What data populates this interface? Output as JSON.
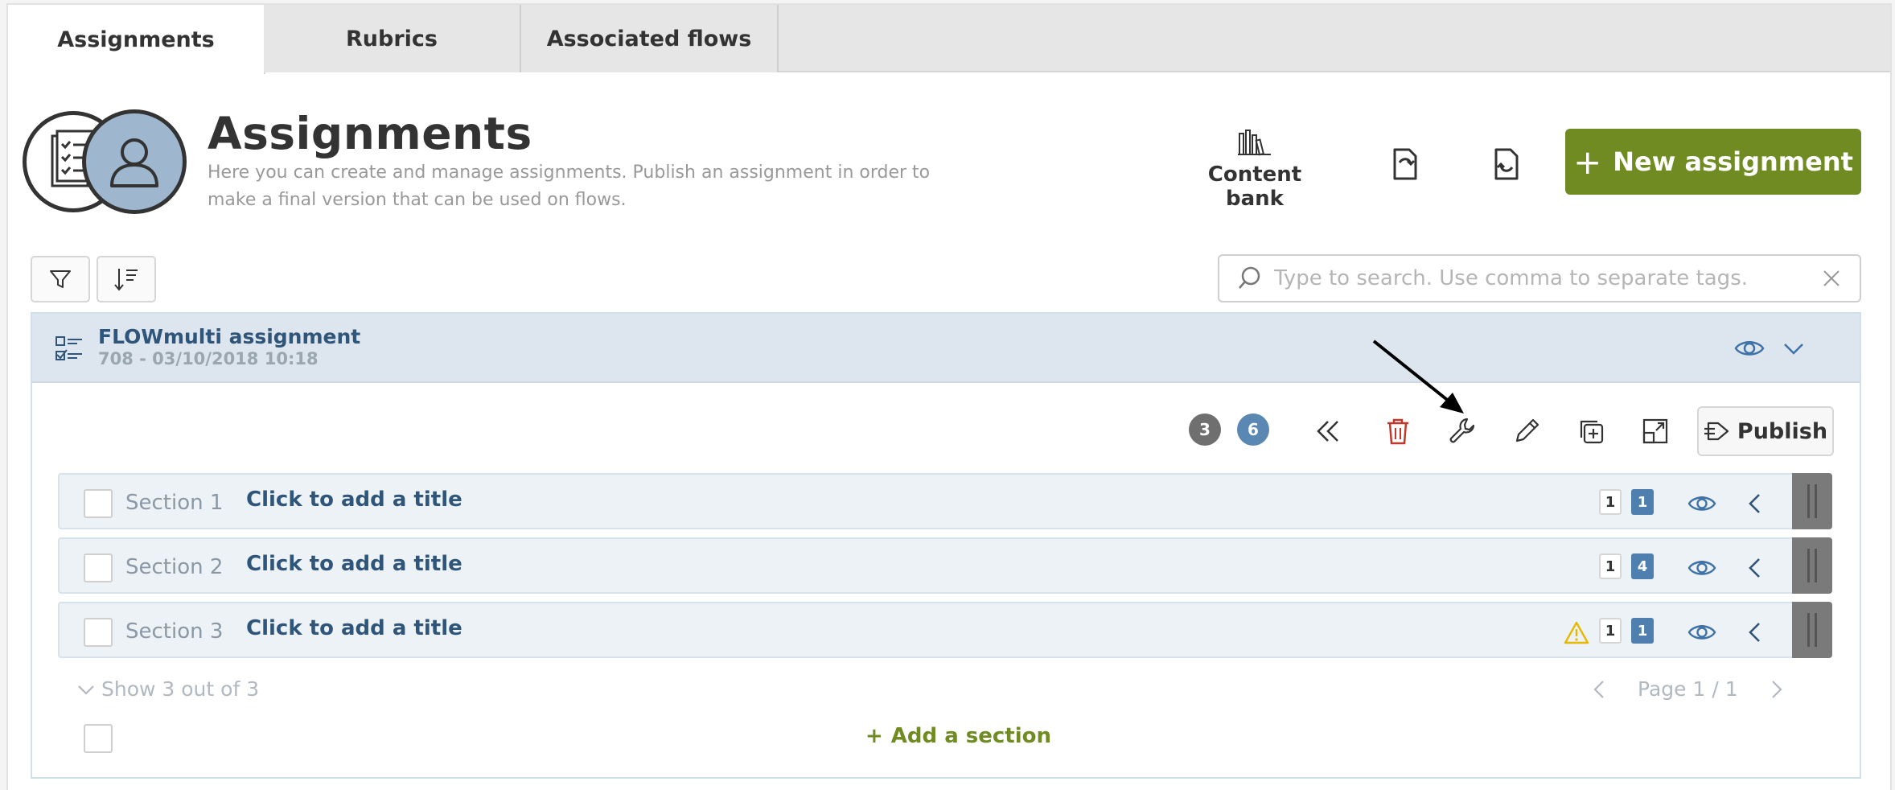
{
  "tabs": [
    {
      "label": "Assignments",
      "active": true
    },
    {
      "label": "Rubrics",
      "active": false
    },
    {
      "label": "Associated flows",
      "active": false
    }
  ],
  "header": {
    "title": "Assignments",
    "description": "Here you can create and manage assignments. Publish an assignment in order to make a final version that can be used on flows.",
    "content_bank_label": "Content bank",
    "new_assignment_label": "New assignment"
  },
  "search": {
    "placeholder": "Type to search. Use comma to separate tags."
  },
  "assignment": {
    "name": "FLOWmulti assignment",
    "meta": "708 - 03/10/2018 10:18",
    "counter_gray": "3",
    "counter_blue": "6",
    "publish_label": "Publish"
  },
  "sections": [
    {
      "label": "Section 1",
      "title": "Click to add a title",
      "badge_white": "1",
      "badge_blue": "1",
      "warning": false
    },
    {
      "label": "Section 2",
      "title": "Click to add a title",
      "badge_white": "1",
      "badge_blue": "4",
      "warning": false
    },
    {
      "label": "Section 3",
      "title": "Click to add a title",
      "badge_white": "1",
      "badge_blue": "1",
      "warning": true
    }
  ],
  "footer": {
    "show_more": "Show 3 out of 3",
    "page": "Page 1 / 1",
    "add_section": "Add a section"
  },
  "colors": {
    "primary_green": "#6f8b22",
    "accent_blue": "#5b87b3",
    "title_blue": "#2f557a",
    "delete_red": "#c0392b",
    "warning_yellow": "#e6b800"
  }
}
